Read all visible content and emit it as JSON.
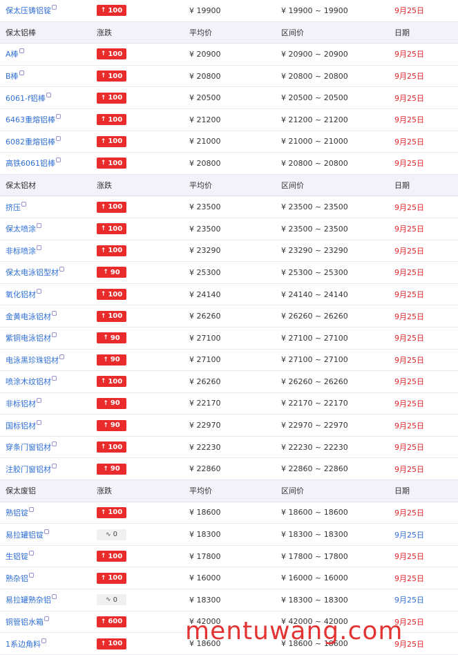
{
  "table": {
    "groups": [
      {
        "header": null,
        "rows": [
          {
            "name": "保太压铸铝锭",
            "change": "100",
            "trend": "up",
            "avg": "¥  19900",
            "range": "¥  19900 ~ 19900",
            "date": "9月25日",
            "date_color": "red"
          }
        ]
      },
      {
        "header": {
          "name": "保太铝棒",
          "change": "涨跌",
          "avg": "平均价",
          "range": "区间价",
          "date": "日期"
        },
        "rows": [
          {
            "name": "A棒",
            "change": "100",
            "trend": "up",
            "avg": "¥  20900",
            "range": "¥  20900 ~ 20900",
            "date": "9月25日",
            "date_color": "red"
          },
          {
            "name": "B棒",
            "change": "100",
            "trend": "up",
            "avg": "¥  20800",
            "range": "¥  20800 ~ 20800",
            "date": "9月25日",
            "date_color": "red"
          },
          {
            "name": "6061-f铝棒",
            "change": "100",
            "trend": "up",
            "avg": "¥  20500",
            "range": "¥  20500 ~ 20500",
            "date": "9月25日",
            "date_color": "red"
          },
          {
            "name": "6463重熔铝棒",
            "change": "100",
            "trend": "up",
            "avg": "¥  21200",
            "range": "¥  21200 ~ 21200",
            "date": "9月25日",
            "date_color": "red"
          },
          {
            "name": "6082重熔铝棒",
            "change": "100",
            "trend": "up",
            "avg": "¥  21000",
            "range": "¥  21000 ~ 21000",
            "date": "9月25日",
            "date_color": "red"
          },
          {
            "name": "高铁6061铝棒",
            "change": "100",
            "trend": "up",
            "avg": "¥  20800",
            "range": "¥  20800 ~ 20800",
            "date": "9月25日",
            "date_color": "red"
          }
        ]
      },
      {
        "header": {
          "name": "保太铝材",
          "change": "涨跌",
          "avg": "平均价",
          "range": "区间价",
          "date": "日期"
        },
        "rows": [
          {
            "name": "挤压",
            "change": "100",
            "trend": "up",
            "avg": "¥  23500",
            "range": "¥  23500 ~ 23500",
            "date": "9月25日",
            "date_color": "red"
          },
          {
            "name": "保太喷涂",
            "change": "100",
            "trend": "up",
            "avg": "¥  23500",
            "range": "¥  23500 ~ 23500",
            "date": "9月25日",
            "date_color": "red"
          },
          {
            "name": "非标喷涂",
            "change": "100",
            "trend": "up",
            "avg": "¥  23290",
            "range": "¥  23290 ~ 23290",
            "date": "9月25日",
            "date_color": "red"
          },
          {
            "name": "保太电泳铝型材",
            "change": "90",
            "trend": "up",
            "avg": "¥  25300",
            "range": "¥  25300 ~ 25300",
            "date": "9月25日",
            "date_color": "red"
          },
          {
            "name": "氧化铝材",
            "change": "100",
            "trend": "up",
            "avg": "¥  24140",
            "range": "¥  24140 ~ 24140",
            "date": "9月25日",
            "date_color": "red"
          },
          {
            "name": "金黄电泳铝材",
            "change": "100",
            "trend": "up",
            "avg": "¥  26260",
            "range": "¥  26260 ~ 26260",
            "date": "9月25日",
            "date_color": "red"
          },
          {
            "name": "紫铜电泳铝材",
            "change": "90",
            "trend": "up",
            "avg": "¥  27100",
            "range": "¥  27100 ~ 27100",
            "date": "9月25日",
            "date_color": "red"
          },
          {
            "name": "电泳黑珍珠铝材",
            "change": "90",
            "trend": "up",
            "avg": "¥  27100",
            "range": "¥  27100 ~ 27100",
            "date": "9月25日",
            "date_color": "red"
          },
          {
            "name": "喷涂木纹铝材",
            "change": "100",
            "trend": "up",
            "avg": "¥  26260",
            "range": "¥  26260 ~ 26260",
            "date": "9月25日",
            "date_color": "red"
          },
          {
            "name": "非标铝材",
            "change": "90",
            "trend": "up",
            "avg": "¥  22170",
            "range": "¥  22170 ~ 22170",
            "date": "9月25日",
            "date_color": "red"
          },
          {
            "name": "国标铝材",
            "change": "90",
            "trend": "up",
            "avg": "¥  22970",
            "range": "¥  22970 ~ 22970",
            "date": "9月25日",
            "date_color": "red"
          },
          {
            "name": "穿条门窗铝材",
            "change": "100",
            "trend": "up",
            "avg": "¥  22230",
            "range": "¥  22230 ~ 22230",
            "date": "9月25日",
            "date_color": "red"
          },
          {
            "name": "注胶门窗铝材",
            "change": "90",
            "trend": "up",
            "avg": "¥  22860",
            "range": "¥  22860 ~ 22860",
            "date": "9月25日",
            "date_color": "red"
          }
        ]
      },
      {
        "header": {
          "name": "保太废铝",
          "change": "涨跌",
          "avg": "平均价",
          "range": "区间价",
          "date": "日期"
        },
        "rows": [
          {
            "name": "熟铝锭",
            "change": "100",
            "trend": "up",
            "avg": "¥  18600",
            "range": "¥  18600 ~ 18600",
            "date": "9月25日",
            "date_color": "red"
          },
          {
            "name": "易拉罐铝锭",
            "change": "0",
            "trend": "flat",
            "avg": "¥  18300",
            "range": "¥  18300 ~ 18300",
            "date": "9月25日",
            "date_color": "blue"
          },
          {
            "name": "生铝锭",
            "change": "100",
            "trend": "up",
            "avg": "¥  17800",
            "range": "¥  17800 ~ 17800",
            "date": "9月25日",
            "date_color": "red"
          },
          {
            "name": "熟杂铝",
            "change": "100",
            "trend": "up",
            "avg": "¥  16000",
            "range": "¥  16000 ~ 16000",
            "date": "9月25日",
            "date_color": "red"
          },
          {
            "name": "易拉罐熟杂铝",
            "change": "0",
            "trend": "flat",
            "avg": "¥  18300",
            "range": "¥  18300 ~ 18300",
            "date": "9月25日",
            "date_color": "blue"
          },
          {
            "name": "铜管铝水箱",
            "change": "600",
            "trend": "up",
            "avg": "¥  42000",
            "range": "¥  42000 ~ 42000",
            "date": "9月25日",
            "date_color": "red"
          },
          {
            "name": "1系边角料",
            "change": "100",
            "trend": "up",
            "avg": "¥  18600",
            "range": "¥  18600 ~ 18600",
            "date": "9月25日",
            "date_color": "red"
          }
        ]
      }
    ]
  },
  "icons": {
    "up": "arrow-up-icon",
    "flat": "wave-icon"
  },
  "colors": {
    "up_badge": "#ea2b2b",
    "date_red": "#e0262b",
    "link_blue": "#2f6fd6",
    "header_bg": "#f4f1fb"
  },
  "watermark": "mentuwang.com"
}
